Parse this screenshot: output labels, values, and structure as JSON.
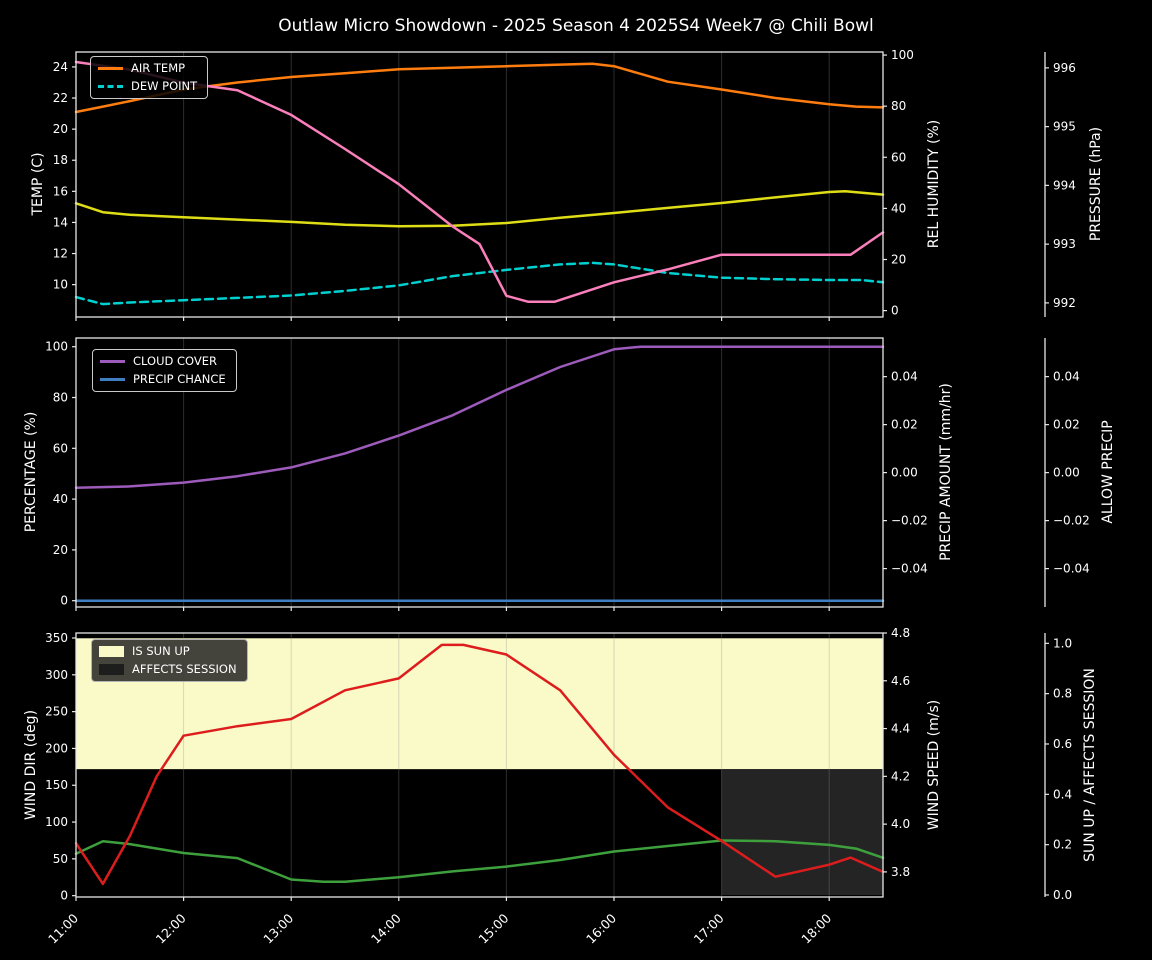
{
  "title": "Outlaw Micro Showdown - 2025 Season 4 2025S4 Week7 @ Chili Bowl",
  "colors": {
    "background": "#000000",
    "foreground": "#ffffff",
    "spine": "#e8e8e8",
    "grid": "rgba(140,140,140,0.32)",
    "air_temp": "#ff7d0e",
    "dew_point": "#00d0d0",
    "rel_humidity": "#dedd16",
    "pressure": "#fb7fbb",
    "cloud_cover": "#9d5bbb",
    "precip_chance": "#3f7fc1",
    "precip_amount_label": "#c96a35",
    "wind_dir": "#3ea03c",
    "wind_speed": "#dd1d1d",
    "sun_up_fill": "#fafac8",
    "affects_session_fill": "#242424"
  },
  "chart_data": {
    "type": "line",
    "title": "Outlaw Micro Showdown - 2025 Season 4 2025S4 Week7 @ Chili Bowl",
    "x": {
      "lim": [
        11,
        18.5
      ],
      "grid": true,
      "tick_hours": [
        11,
        12,
        13,
        14,
        15,
        16,
        17,
        18
      ],
      "tick_labels": [
        "11:00",
        "12:00",
        "13:00",
        "14:00",
        "15:00",
        "16:00",
        "17:00",
        "18:00"
      ]
    },
    "panels": [
      {
        "name": "temperature-panel",
        "axes": {
          "temp": {
            "side": "left",
            "offset": 0,
            "label": "TEMP (C)",
            "label_color": "#ffffff",
            "lim": [
              7.92,
              24.96
            ],
            "tick_values": [
              10,
              12,
              14,
              16,
              18,
              20,
              22,
              24
            ],
            "tick_labels": [
              "10",
              "12",
              "14",
              "16",
              "18",
              "20",
              "22",
              "24"
            ]
          },
          "rh": {
            "side": "right",
            "offset": 0,
            "label": "REL HUMIDITY (%)",
            "label_color": "#dedd16",
            "lim": [
              -2.5,
              101.2
            ],
            "tick_values": [
              0,
              20,
              40,
              60,
              80,
              100
            ],
            "tick_labels": [
              "0",
              "20",
              "40",
              "60",
              "80",
              "100"
            ]
          },
          "pres": {
            "side": "right",
            "offset": 1,
            "label": "PRESSURE (hPa)",
            "label_color": "#fb7fbb",
            "lim": [
              991.76,
              996.27
            ],
            "tick_values": [
              992,
              993,
              994,
              995,
              996
            ],
            "tick_labels": [
              "992",
              "993",
              "994",
              "995",
              "996"
            ]
          }
        },
        "legend": {
          "items": [
            {
              "label": "AIR TEMP",
              "color": "#ff7d0e",
              "swatch": "line"
            },
            {
              "label": "DEW POINT",
              "color": "#00d0d0",
              "swatch": "dashed-line"
            }
          ]
        },
        "series": [
          {
            "name": "AIR TEMP",
            "axis": "temp",
            "color": "#ff7d0e",
            "dash": false,
            "points": [
              [
                11,
                21.1
              ],
              [
                11.25,
                21.45
              ],
              [
                11.5,
                21.8
              ],
              [
                12,
                22.55
              ],
              [
                12.5,
                23.0
              ],
              [
                13,
                23.35
              ],
              [
                13.5,
                23.6
              ],
              [
                14,
                23.85
              ],
              [
                14.5,
                23.95
              ],
              [
                15,
                24.05
              ],
              [
                15.5,
                24.15
              ],
              [
                15.8,
                24.2
              ],
              [
                16,
                24.05
              ],
              [
                16.5,
                23.05
              ],
              [
                17,
                22.55
              ],
              [
                17.5,
                22.0
              ],
              [
                18,
                21.6
              ],
              [
                18.25,
                21.45
              ],
              [
                18.5,
                21.4
              ]
            ]
          },
          {
            "name": "DEW POINT",
            "axis": "temp",
            "color": "#00d0d0",
            "dash": true,
            "points": [
              [
                11,
                9.2
              ],
              [
                11.25,
                8.75
              ],
              [
                11.5,
                8.85
              ],
              [
                12,
                9.0
              ],
              [
                12.5,
                9.15
              ],
              [
                13,
                9.3
              ],
              [
                13.5,
                9.6
              ],
              [
                14,
                9.95
              ],
              [
                14.5,
                10.55
              ],
              [
                15,
                10.95
              ],
              [
                15.5,
                11.3
              ],
              [
                15.8,
                11.4
              ],
              [
                16,
                11.3
              ],
              [
                16.5,
                10.75
              ],
              [
                17,
                10.45
              ],
              [
                17.5,
                10.35
              ],
              [
                18,
                10.3
              ],
              [
                18.3,
                10.3
              ],
              [
                18.5,
                10.15
              ]
            ]
          },
          {
            "name": "REL HUMIDITY",
            "axis": "rh",
            "color": "#dedd16",
            "dash": false,
            "points": [
              [
                11,
                42
              ],
              [
                11.25,
                38.5
              ],
              [
                11.5,
                37.5
              ],
              [
                12,
                36.5
              ],
              [
                12.5,
                35.6
              ],
              [
                13,
                34.7
              ],
              [
                13.5,
                33.6
              ],
              [
                14,
                33.0
              ],
              [
                14.5,
                33.2
              ],
              [
                15,
                34.3
              ],
              [
                15.5,
                36.3
              ],
              [
                16,
                38.2
              ],
              [
                16.5,
                40.2
              ],
              [
                17,
                42.1
              ],
              [
                17.5,
                44.3
              ],
              [
                18,
                46.4
              ],
              [
                18.15,
                46.7
              ],
              [
                18.5,
                45.4
              ]
            ]
          },
          {
            "name": "PRESSURE",
            "axis": "pres",
            "color": "#fb7fbb",
            "dash": false,
            "points": [
              [
                11,
                996.1
              ],
              [
                11.5,
                995.97
              ],
              [
                12,
                995.75
              ],
              [
                12.5,
                995.62
              ],
              [
                13,
                995.2
              ],
              [
                13.5,
                994.62
              ],
              [
                14,
                994.02
              ],
              [
                14.5,
                993.3
              ],
              [
                14.75,
                993.0
              ],
              [
                15,
                992.12
              ],
              [
                15.2,
                992.02
              ],
              [
                15.45,
                992.02
              ],
              [
                16,
                992.35
              ],
              [
                16.5,
                992.57
              ],
              [
                17,
                992.82
              ],
              [
                18.2,
                992.82
              ],
              [
                18.5,
                993.2
              ]
            ]
          }
        ]
      },
      {
        "name": "percentage-panel",
        "axes": {
          "pct": {
            "side": "left",
            "offset": 0,
            "label": "PERCENTAGE (%)",
            "label_color": "#ffffff",
            "lim": [
              -2.48,
              103.43
            ],
            "tick_values": [
              0,
              20,
              40,
              60,
              80,
              100
            ],
            "tick_labels": [
              "0",
              "20",
              "40",
              "60",
              "80",
              "100"
            ]
          },
          "precip": {
            "side": "right",
            "offset": 0,
            "label": "PRECIP AMOUNT (mm/hr)",
            "label_color": "#c96a35",
            "lim": [
              -0.056,
              0.0561
            ],
            "tick_values": [
              -0.04,
              -0.02,
              0,
              0.02,
              0.04
            ],
            "tick_labels": [
              "−0.04",
              "−0.02",
              "0.00",
              "0.02",
              "0.04"
            ]
          },
          "allow": {
            "side": "right",
            "offset": 1,
            "label": "ALLOW PRECIP",
            "label_color": "#ffffff",
            "lim": [
              -0.056,
              0.0561
            ],
            "tick_values": [
              -0.04,
              -0.02,
              0,
              0.02,
              0.04
            ],
            "tick_labels": [
              "−0.04",
              "−0.02",
              "0.00",
              "0.02",
              "0.04"
            ]
          }
        },
        "legend": {
          "items": [
            {
              "label": "CLOUD COVER",
              "color": "#9d5bbb",
              "swatch": "line"
            },
            {
              "label": "PRECIP CHANCE",
              "color": "#3f7fc1",
              "swatch": "line"
            }
          ]
        },
        "series": [
          {
            "name": "CLOUD COVER",
            "axis": "pct",
            "color": "#9d5bbb",
            "dash": false,
            "points": [
              [
                11,
                44.5
              ],
              [
                11.5,
                45
              ],
              [
                12,
                46.5
              ],
              [
                12.5,
                49
              ],
              [
                13,
                52.5
              ],
              [
                13.5,
                58
              ],
              [
                14,
                65
              ],
              [
                14.5,
                73
              ],
              [
                15,
                83
              ],
              [
                15.5,
                92
              ],
              [
                16,
                99
              ],
              [
                16.25,
                100
              ],
              [
                18.5,
                100
              ]
            ]
          },
          {
            "name": "PRECIP CHANCE",
            "axis": "pct",
            "color": "#3f7fc1",
            "dash": false,
            "points": [
              [
                11,
                0
              ],
              [
                18.5,
                0
              ]
            ]
          }
        ]
      },
      {
        "name": "wind-panel",
        "axes": {
          "dir": {
            "side": "left",
            "offset": 0,
            "label": "WIND DIR (deg)",
            "label_color": "#3ea03c",
            "lim": [
              -1.8,
              356.8
            ],
            "tick_values": [
              0,
              50,
              100,
              150,
              200,
              250,
              300,
              350
            ],
            "tick_labels": [
              "0",
              "50",
              "100",
              "150",
              "200",
              "250",
              "300",
              "350"
            ]
          },
          "speed": {
            "side": "right",
            "offset": 0,
            "label": "WIND SPEED (m/s)",
            "label_color": "#dd1d1d",
            "lim": [
              3.695,
              4.8
            ],
            "tick_values": [
              3.8,
              4.0,
              4.2,
              4.4,
              4.6,
              4.8
            ],
            "tick_labels": [
              "3.8",
              "4.0",
              "4.2",
              "4.4",
              "4.6",
              "4.8"
            ]
          },
          "sun": {
            "side": "right",
            "offset": 1,
            "label": "SUN UP / AFFECTS SESSION",
            "label_color": "#ffffff",
            "lim": [
              -0.008,
              1.041
            ],
            "tick_values": [
              0,
              0.2,
              0.4,
              0.6,
              0.8,
              1.0
            ],
            "tick_labels": [
              "0.0",
              "0.2",
              "0.4",
              "0.6",
              "0.8",
              "1.0"
            ]
          }
        },
        "legend": {
          "dark": true,
          "items": [
            {
              "label": "IS SUN UP",
              "color": "#fafac8",
              "swatch": "patch"
            },
            {
              "label": "AFFECTS SESSION",
              "color": "#1d1d1d",
              "swatch": "patch"
            }
          ]
        },
        "fills": [
          {
            "name": "IS SUN UP",
            "axis": "sun",
            "color": "#fafac8",
            "x": [
              11,
              18.5
            ],
            "y": [
              0.5,
              1.02
            ]
          },
          {
            "name": "AFFECTS SESSION",
            "axis": "sun",
            "color": "#242424",
            "x": [
              17,
              18.5
            ],
            "y": [
              0.0,
              0.5
            ]
          }
        ],
        "series": [
          {
            "name": "WIND DIR",
            "axis": "dir",
            "color": "#3ea03c",
            "dash": false,
            "points": [
              [
                11,
                57
              ],
              [
                11.25,
                74
              ],
              [
                11.5,
                70
              ],
              [
                12,
                58
              ],
              [
                12.5,
                51
              ],
              [
                13,
                22
              ],
              [
                13.3,
                19
              ],
              [
                13.5,
                19
              ],
              [
                14,
                25
              ],
              [
                14.5,
                33
              ],
              [
                15,
                39.5
              ],
              [
                15.5,
                48.5
              ],
              [
                16,
                60
              ],
              [
                16.5,
                67.5
              ],
              [
                17,
                75
              ],
              [
                17.5,
                74
              ],
              [
                18,
                69
              ],
              [
                18.25,
                64
              ],
              [
                18.5,
                51.5
              ]
            ]
          },
          {
            "name": "WIND SPEED",
            "axis": "speed",
            "color": "#dd1d1d",
            "dash": false,
            "points": [
              [
                11,
                3.92
              ],
              [
                11.25,
                3.75
              ],
              [
                11.5,
                3.95
              ],
              [
                11.75,
                4.2
              ],
              [
                12,
                4.37
              ],
              [
                12.5,
                4.41
              ],
              [
                13,
                4.44
              ],
              [
                13.5,
                4.56
              ],
              [
                14,
                4.61
              ],
              [
                14.4,
                4.75
              ],
              [
                14.6,
                4.75
              ],
              [
                15,
                4.71
              ],
              [
                15.5,
                4.56
              ],
              [
                16,
                4.29
              ],
              [
                16.5,
                4.07
              ],
              [
                17,
                3.93
              ],
              [
                17.5,
                3.78
              ],
              [
                18,
                3.83
              ],
              [
                18.2,
                3.86
              ],
              [
                18.5,
                3.8
              ]
            ]
          }
        ]
      }
    ]
  }
}
